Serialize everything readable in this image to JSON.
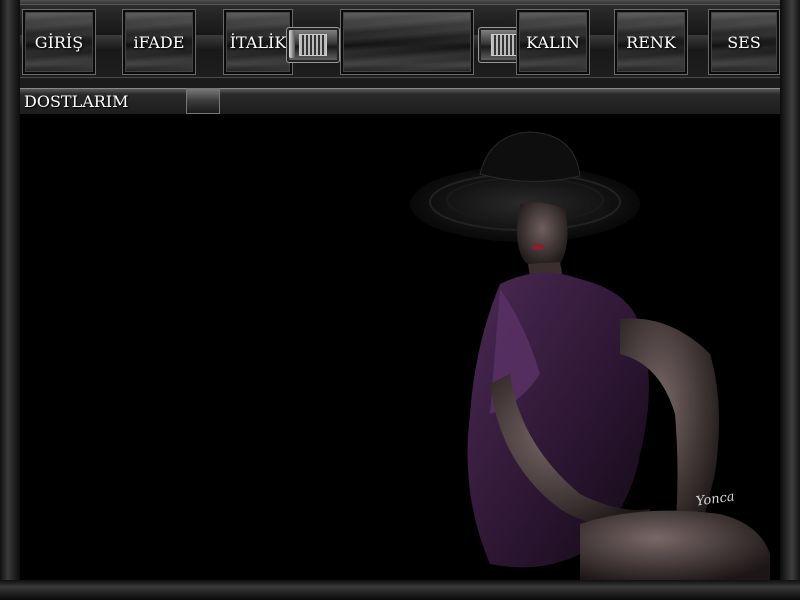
{
  "toolbar": {
    "buttons": [
      {
        "label": "GİRİŞ"
      },
      {
        "label": "iFADE"
      },
      {
        "label": "İTALİK"
      },
      {
        "label": ""
      },
      {
        "label": "KALIN"
      },
      {
        "label": "RENK"
      },
      {
        "label": "SES"
      }
    ]
  },
  "section": {
    "title": "DOSTLARIM"
  },
  "content": {
    "signature": "Yonca"
  },
  "colors": {
    "dress": "#3b1f42",
    "background": "#000000",
    "frame": "#2a2a2a"
  }
}
